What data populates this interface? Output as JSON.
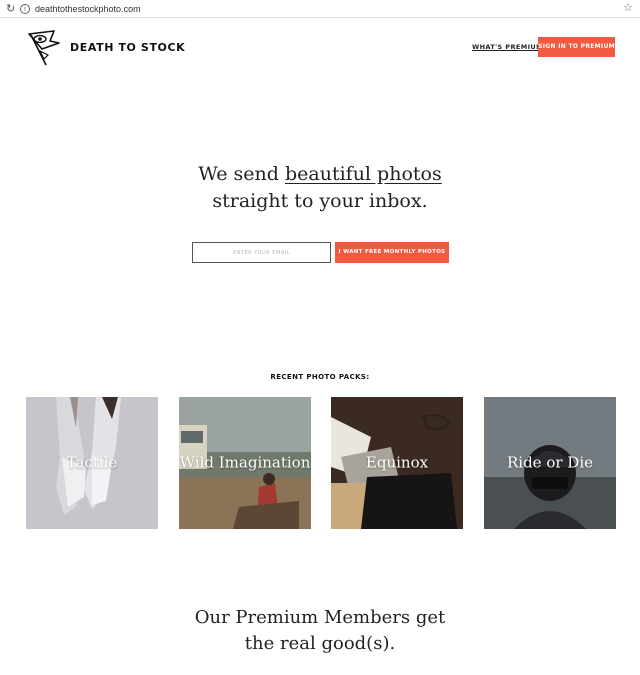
{
  "browser": {
    "url": "deathtothestockphoto.com",
    "reload_icon": "reload-icon",
    "info_icon": "info-icon",
    "star_icon": "star-icon"
  },
  "header": {
    "brand": "DEATH TO STOCK",
    "logo_icon": "eye-flag-logo-icon",
    "nav_premium": "WHAT'S PREMIUM?",
    "signin_label": "SIGN IN TO PREMIUM"
  },
  "hero": {
    "line1_prefix": "We send ",
    "line1_link": "beautiful photos",
    "line2": "straight to your inbox.",
    "email_placeholder": "ENTER YOUR EMAIL",
    "cta_label": "I WANT FREE MONTHLY PHOTOS"
  },
  "packs": {
    "title": "RECENT PHOTO PACKS:",
    "items": [
      {
        "label": "Tactile"
      },
      {
        "label": "Wild Imagination"
      },
      {
        "label": "Equinox"
      },
      {
        "label": "Ride or Die"
      }
    ]
  },
  "premium": {
    "line1": "Our Premium Members get",
    "line2": "the real good(s)."
  },
  "colors": {
    "accent": "#f15a3f",
    "text": "#222222"
  }
}
